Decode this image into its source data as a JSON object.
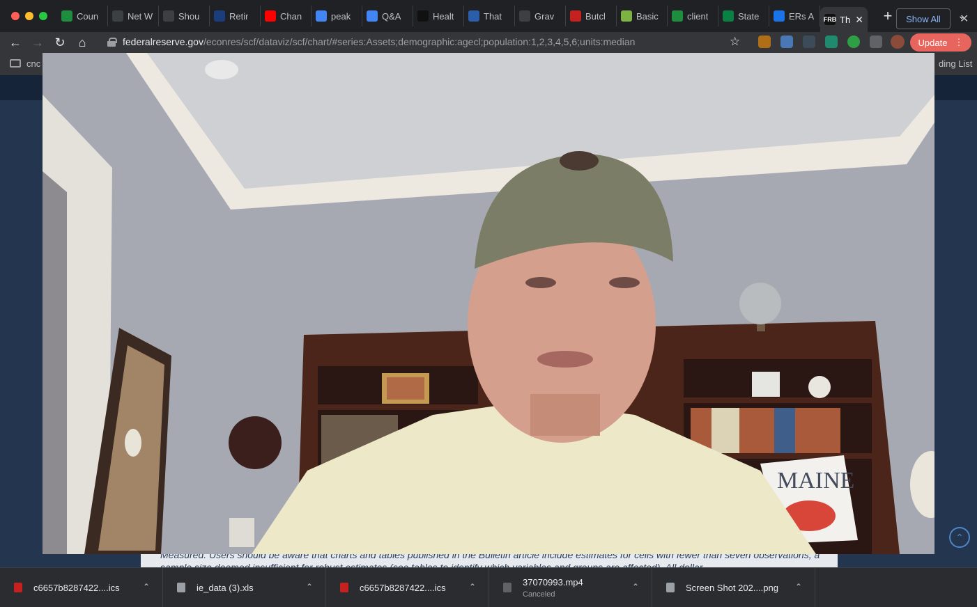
{
  "browser": {
    "tabs": [
      {
        "label": "Coun",
        "icon": "sheets-icon",
        "color": "#1e8e3e"
      },
      {
        "label": "Net W",
        "icon": "refresh-logo-icon",
        "color": "#3c4043"
      },
      {
        "label": "Shou",
        "icon": "wm-icon",
        "color": "#3c4043"
      },
      {
        "label": "Retir",
        "icon": "gao-icon",
        "color": "#1a3d7c"
      },
      {
        "label": "Chan",
        "icon": "youtube-icon",
        "color": "#ff0000"
      },
      {
        "label": "peak",
        "icon": "docs-icon",
        "color": "#4285f4"
      },
      {
        "label": "Q&A",
        "icon": "docs-icon",
        "color": "#4285f4"
      },
      {
        "label": "Healt",
        "icon": "hc-icon",
        "color": "#111111"
      },
      {
        "label": "That",
        "icon": "mi-icon",
        "color": "#2a5ea8"
      },
      {
        "label": "Grav",
        "icon": "globe-icon",
        "color": "#3c4043"
      },
      {
        "label": "Butcl",
        "icon": "pin-icon",
        "color": "#c5221f"
      },
      {
        "label": "Basic",
        "icon": "diamond-icon",
        "color": "#7cb342"
      },
      {
        "label": "client",
        "icon": "sheets-icon",
        "color": "#1e8e3e"
      },
      {
        "label": "State",
        "icon": "c-logo-icon",
        "color": "#0b8043"
      },
      {
        "label": "ERs A",
        "icon": "k-logo-icon",
        "color": "#1a73e8"
      }
    ],
    "active_tab": {
      "label": "Th",
      "icon": "frb-icon",
      "close": "✕"
    },
    "new_tab": "+",
    "url_domain": "federalreserve.gov",
    "url_path": "/econres/scf/dataviz/scf/chart/#series:Assets;demographic:agecl;population:1,2,3,4,5,6;units:median",
    "update_label": "Update",
    "update_menu": "⋮"
  },
  "bookmarks": {
    "first": "cnc",
    "reading_list": "ding List"
  },
  "page": {
    "footnote": "Measured. Users should be aware that charts and tables published in the Bulletin article include estimates for cells with fewer than seven observations, a sample size deemed insufficient for robust estimates (see tables to identify which variables and groups are affected). All dollar"
  },
  "video": {
    "pillow_text": "MAINE",
    "colors": {
      "wall": "#a7a9b2",
      "ceiling": "#cfd0d4",
      "shirt": "#ede8c8",
      "bookcase": "#4b2519"
    }
  },
  "downloads": {
    "items": [
      {
        "name": "c6657b8287422....ics",
        "status": "",
        "icon_color": "#c5221f"
      },
      {
        "name": "ie_data (3).xls",
        "status": "",
        "icon_color": "#9aa0a6"
      },
      {
        "name": "c6657b8287422....ics",
        "status": "",
        "icon_color": "#c5221f"
      },
      {
        "name": "37070993.mp4",
        "status": "Canceled",
        "icon_color": "#5f6368"
      },
      {
        "name": "Screen Shot 202....png",
        "status": "",
        "icon_color": "#9aa0a6"
      }
    ],
    "show_all": "Show All",
    "close": "✕"
  }
}
